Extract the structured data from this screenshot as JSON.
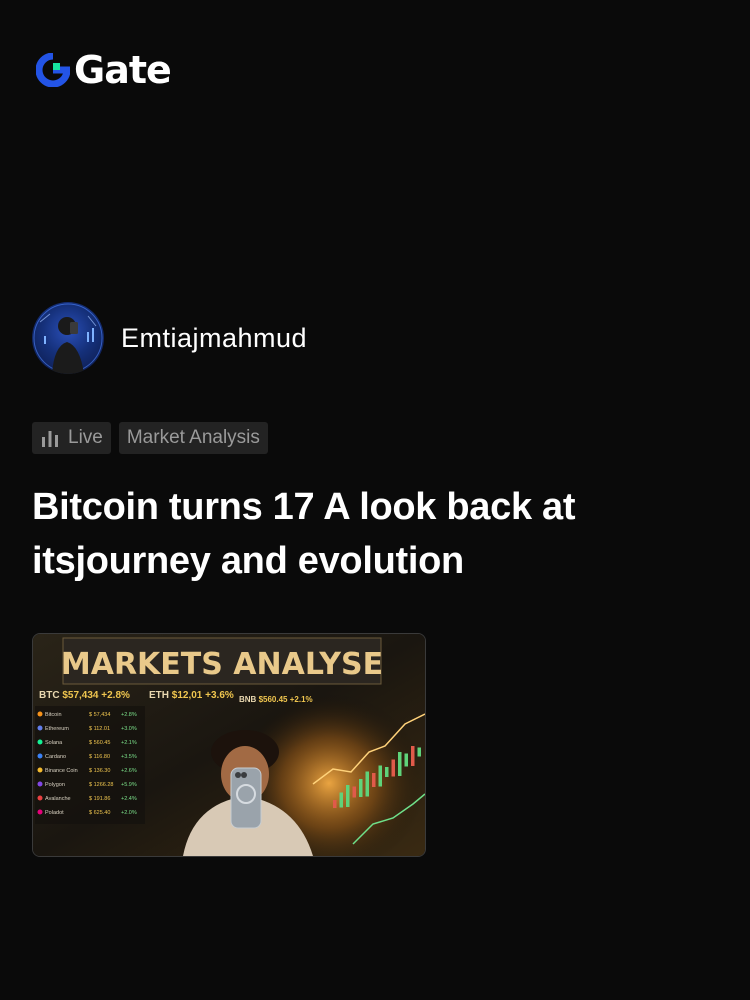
{
  "brand": {
    "name": "Gate",
    "accent": "#2354e6",
    "mark_green": "#17e5a1"
  },
  "author": {
    "name": "Emtiajmahmud"
  },
  "tags": [
    {
      "label": "Live",
      "icon": "bar-chart-icon"
    },
    {
      "label": "Market Analysis"
    }
  ],
  "post": {
    "title": "Bitcoin turns 17 A look back at itsjourney and evolution"
  },
  "thumbnail": {
    "headline": "MARKETS ANALYSE",
    "tickers": [
      {
        "symbol": "BTC",
        "price": "$57,434",
        "change": "+2.8%"
      },
      {
        "symbol": "ETH",
        "price": "$12,01",
        "change": "+3.6%"
      },
      {
        "symbol": "BNB",
        "price": "$560.45",
        "change": "+2.1%"
      }
    ],
    "coins": [
      {
        "name": "Bitcoin",
        "price": "$ 57,434",
        "change": "+2.8%"
      },
      {
        "name": "Ethereum",
        "price": "$ 112.01",
        "change": "+3.0%"
      },
      {
        "name": "Solana",
        "price": "$ 560.45",
        "change": "+2.1%"
      },
      {
        "name": "Cardano",
        "price": "$ 116.80",
        "change": "+3.5%"
      },
      {
        "name": "Binance Coin",
        "price": "$ 136.30",
        "change": "+2.6%"
      },
      {
        "name": "Polygon",
        "price": "$ 1266.28",
        "change": "+5.9%"
      },
      {
        "name": "Avalanche",
        "price": "$ 191.86",
        "change": "+2.4%"
      },
      {
        "name": "Poladot",
        "price": "$ 625.40",
        "change": "+2.0%"
      }
    ]
  }
}
